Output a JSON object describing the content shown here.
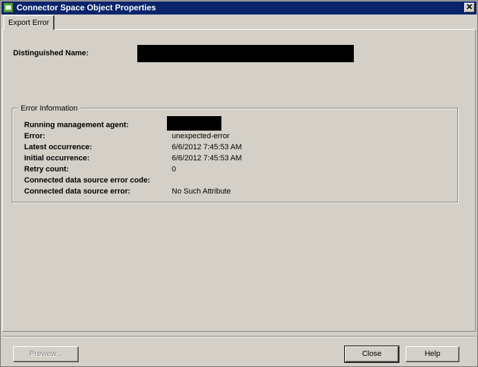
{
  "window": {
    "title": "Connector Space Object Properties",
    "close_glyph": "✕"
  },
  "tabs": [
    {
      "label": "Export Error",
      "selected": true
    }
  ],
  "distinguished_name": {
    "label": "Distinguished Name:",
    "value_redacted": true
  },
  "error_information": {
    "group_title": "Error Information",
    "rows": [
      {
        "label": "Running management agent:",
        "value": "",
        "redacted": true
      },
      {
        "label": "Error:",
        "value": "unexpected-error"
      },
      {
        "label": "Latest occurrence:",
        "value": "6/6/2012 7:45:53 AM"
      },
      {
        "label": "Initial occurrence:",
        "value": "6/6/2012 7:45:53 AM"
      },
      {
        "label": "Retry count:",
        "value": "0"
      },
      {
        "label": "Connected data source error code:",
        "value": ""
      },
      {
        "label": "Connected data source error:",
        "value": "No Such Attribute"
      }
    ]
  },
  "buttons": {
    "preview": {
      "label": "Preview...",
      "enabled": false
    },
    "close": {
      "label": "Close",
      "enabled": true
    },
    "help": {
      "label": "Help",
      "enabled": true
    }
  },
  "colors": {
    "titlebar": "#0a246a",
    "face": "#d4d0c8",
    "redaction": "#000000"
  }
}
